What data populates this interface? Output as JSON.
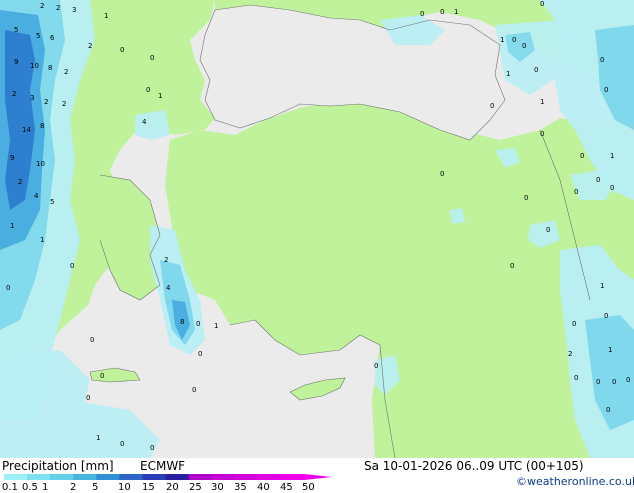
{
  "footer": {
    "title": "Precipitation [mm]",
    "model": "ECMWF",
    "datetime": "Sa 10-01-2026 06..09 UTC (00+105)",
    "credit": "©weatheronline.co.uk"
  },
  "legend": {
    "labels": [
      "0.1",
      "0.5",
      "1",
      "2",
      "5",
      "10",
      "15",
      "20",
      "25",
      "30",
      "35",
      "40",
      "45",
      "50"
    ],
    "colors": [
      "#9ef0f6",
      "#7fe0ef",
      "#64cfe8",
      "#48b6e0",
      "#2f8fd4",
      "#2c64c8",
      "#2a3cb6",
      "#28209c",
      "#b000cc",
      "#c400d4",
      "#d400dc",
      "#e200e4",
      "#ef00ec"
    ]
  },
  "map_colors": {
    "sea": "#ebebeb",
    "land_dry": "#bff29b",
    "precip_light": "#b8eef5",
    "precip_mid": "#7fd8ec",
    "precip_heavy": "#4aaee0",
    "precip_very_heavy": "#2f7fd0"
  },
  "point_labels": [
    "2",
    "5",
    "3",
    "6",
    "9",
    "8",
    "1",
    "0",
    "4",
    "14",
    "10",
    "16",
    "7"
  ]
}
